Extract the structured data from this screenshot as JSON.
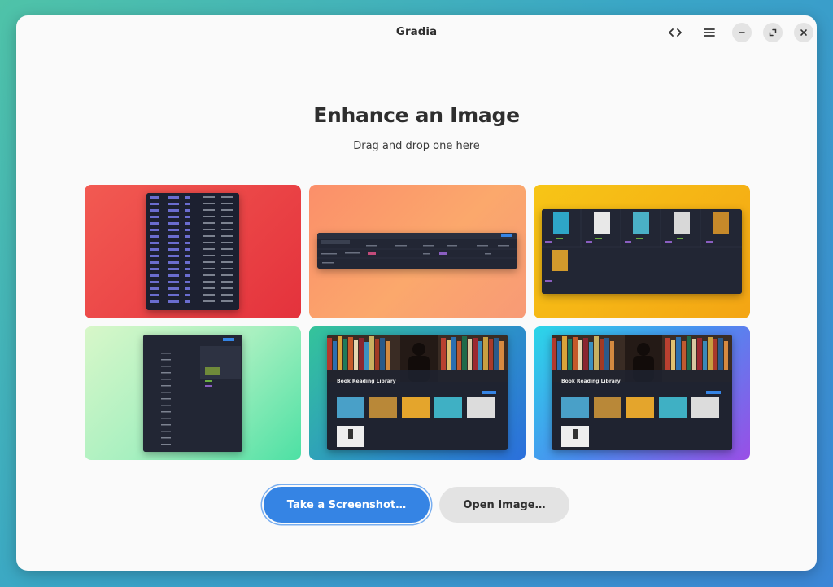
{
  "window": {
    "title": "Gradia"
  },
  "headerbar": {
    "source_icon": "code-brackets-icon",
    "menu_icon": "hamburger-menu-icon",
    "minimize_icon": "minimize-icon",
    "maximize_icon": "maximize-icon",
    "close_icon": "close-icon"
  },
  "main": {
    "heading": "Enhance an Image",
    "subheading": "Drag and drop one here"
  },
  "examples": [
    {
      "background": "red-gradient"
    },
    {
      "background": "peach-gradient"
    },
    {
      "background": "yellow-gradient"
    },
    {
      "background": "mint-gradient"
    },
    {
      "background": "teal-blue-gradient"
    },
    {
      "background": "cyan-purple-gradient"
    }
  ],
  "library_preview": {
    "title": "Book Reading Library"
  },
  "actions": {
    "screenshot_label": "Take a Screenshot…",
    "open_label": "Open Image…"
  },
  "colors": {
    "accent": "#3584e4",
    "window_bg": "#fafafa"
  }
}
